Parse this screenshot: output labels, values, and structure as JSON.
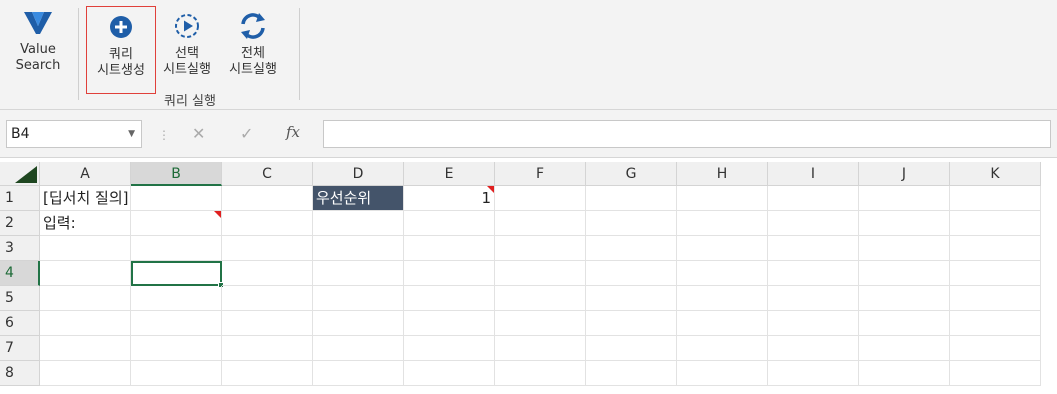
{
  "ribbon": {
    "value_search_label_1": "Value",
    "value_search_label_2": "Search",
    "create_query_label_1": "쿼리",
    "create_query_label_2": "시트생성",
    "run_selected_label_1": "선택",
    "run_selected_label_2": "시트실행",
    "run_all_label_1": "전체",
    "run_all_label_2": "시트실행",
    "group_label": "쿼리 실행"
  },
  "formula_bar": {
    "name_box": "B4",
    "formula": ""
  },
  "grid": {
    "columns": [
      "A",
      "B",
      "C",
      "D",
      "E",
      "F",
      "G",
      "H",
      "I",
      "J",
      "K"
    ],
    "rows": [
      "1",
      "2",
      "3",
      "4",
      "5",
      "6",
      "7",
      "8"
    ],
    "selected_column": "B",
    "selected_row": "4",
    "cells": {
      "A1": "[딥서치 질의]",
      "A2": "입력:",
      "D1": "우선순위",
      "E1": "1"
    }
  },
  "colors": {
    "accent_green": "#217346",
    "header_cell_bg": "#44546a",
    "highlight_border": "#e0403a",
    "icon_blue": "#1f5ea8"
  }
}
